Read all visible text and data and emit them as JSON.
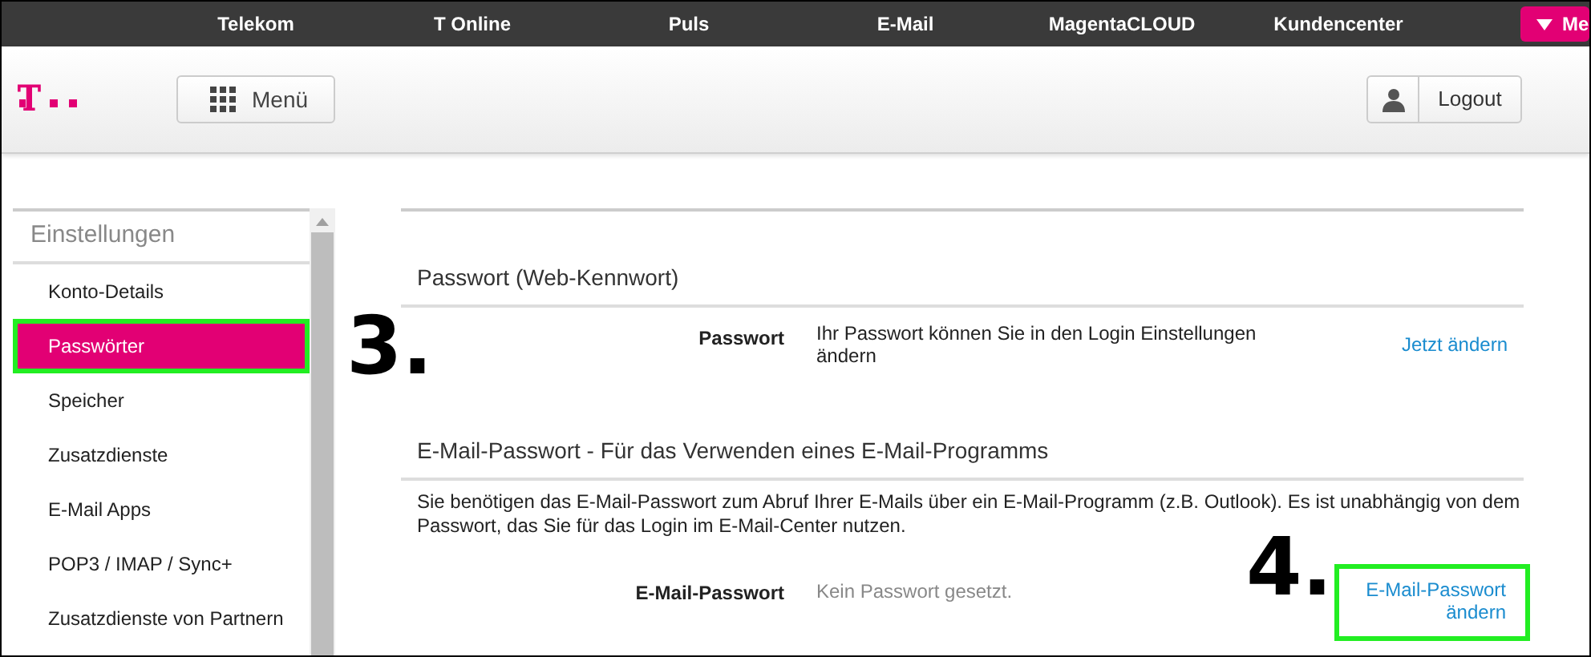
{
  "top_nav": {
    "items": [
      "Telekom",
      "T Online",
      "Puls",
      "E-Mail",
      "MagentaCLOUD",
      "Kundencenter"
    ],
    "more_button": "Me"
  },
  "header": {
    "menu_button": "Menü",
    "logout_button": "Logout"
  },
  "sidebar": {
    "heading": "Einstellungen",
    "items": [
      {
        "label": "Konto-Details",
        "selected": false,
        "highlighted": false
      },
      {
        "label": "Passwörter",
        "selected": true,
        "highlighted": true
      },
      {
        "label": "Speicher",
        "selected": false,
        "highlighted": false
      },
      {
        "label": "Zusatzdienste",
        "selected": false,
        "highlighted": false
      },
      {
        "label": "E-Mail Apps",
        "selected": false,
        "highlighted": false
      },
      {
        "label": "POP3 / IMAP / Sync+",
        "selected": false,
        "highlighted": false
      },
      {
        "label": "Zusatzdienste von Partnern",
        "selected": false,
        "highlighted": false
      }
    ]
  },
  "sections": [
    {
      "title": "Passwort (Web-Kennwort)",
      "row": {
        "label": "Passwort",
        "value": "Ihr Passwort können Sie in den Login Einstellungen ändern",
        "value_muted": false,
        "link": "Jetzt ändern",
        "link_highlighted": false
      }
    },
    {
      "title": "E-Mail-Passwort - Für das Verwenden eines E-Mail-Programms",
      "description": "Sie benötigen das E-Mail-Passwort zum Abruf Ihrer E-Mails über ein E-Mail-Programm (z.B. Outlook). Es ist unabhängig von dem Passwort, das Sie für das Login im E-Mail-Center nutzen.",
      "row": {
        "label": "E-Mail-Passwort",
        "value": "Kein Passwort gesetzt.",
        "value_muted": true,
        "link": "E-Mail-Passwort ändern",
        "link_highlighted": true
      }
    }
  ],
  "annotations": [
    "3.",
    "4."
  ]
}
